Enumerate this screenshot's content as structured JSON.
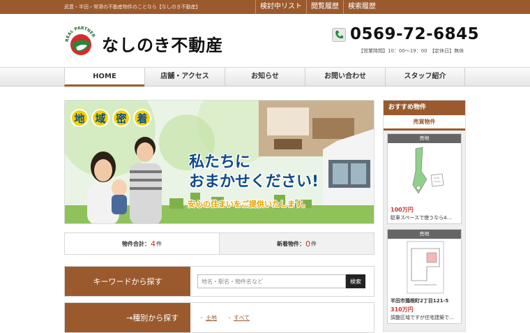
{
  "topbar": {
    "tagline": "武豊・半田・常滑の不動産物件のことなら【なしのき不動産】",
    "links": [
      "検討中リスト",
      "閲覧履歴",
      "検索履歴"
    ]
  },
  "header": {
    "logo_text": "REAL PARTNER",
    "brand": "なしのき不動産",
    "phone": "0569-72-6845",
    "hours": "【営業時間】10：00～19：00　【定休日】無休"
  },
  "nav": {
    "items": [
      "HOME",
      "店舗・アクセス",
      "お知らせ",
      "お問い合わせ",
      "スタッフ紹介"
    ]
  },
  "hero": {
    "chars": [
      "地",
      "域",
      "密",
      "着"
    ],
    "headline_1": "私たちに",
    "headline_2": "おまかせください!",
    "subline": "安心の住まいをご提供いたします。"
  },
  "stats": {
    "total_label": "物件合計：",
    "total_value": "4",
    "total_unit": "件",
    "new_label": "新着物件：",
    "new_value": "0",
    "new_unit": "件"
  },
  "keyword_search": {
    "label": "キーワードから探す",
    "placeholder": "地名・駅名・物件名など",
    "button": "検索"
  },
  "category_search": {
    "label": "→種別から探す",
    "options": [
      "土地",
      "すべて"
    ]
  },
  "sidebar": {
    "heading": "おすすめ物件",
    "subheading": "売買物件",
    "cards": [
      {
        "type": "売地",
        "price": "100万円",
        "desc": "駐車スペースで使うなら4…"
      },
      {
        "type": "売地",
        "address": "半田市鶉根町2丁目121-5",
        "price": "310万円",
        "desc": "調整区域ですが住宅建築で…"
      }
    ]
  },
  "colors": {
    "accent": "#9b5a2e",
    "price": "#c9302c"
  }
}
